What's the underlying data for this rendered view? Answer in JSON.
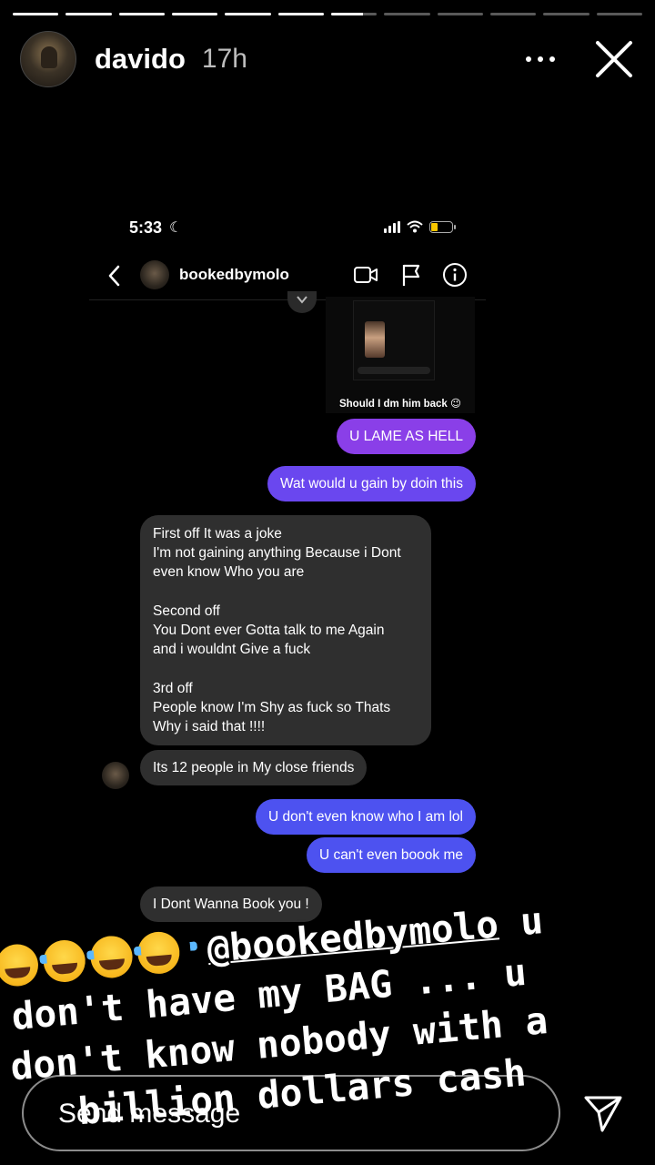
{
  "story": {
    "username": "davido",
    "time": "17h",
    "segments": [
      1,
      1,
      1,
      1,
      1,
      1,
      0.7,
      0,
      0,
      0,
      0,
      0
    ]
  },
  "embedded": {
    "status_time": "5:33",
    "chat_name": "bookedbymolo",
    "shared_caption": "Should I dm him back 😉",
    "messages": [
      {
        "from": "me",
        "text": "U LAME AS HELL"
      },
      {
        "from": "me",
        "text": "Wat would u gain by doin this"
      },
      {
        "from": "them",
        "lines": [
          "First off It was a joke",
          "I'm not gaining anything Because i Dont",
          "even know Who you are",
          "",
          "Second off",
          "You Dont ever Gotta talk to me Again",
          "and i wouldnt Give a fuck",
          "",
          "3rd off",
          "People know I'm Shy as fuck so Thats",
          "Why i said that !!!!"
        ]
      },
      {
        "from": "them",
        "text": "Its 12 people in My close friends"
      },
      {
        "from": "me",
        "text": "U don't even know who I am lol"
      },
      {
        "from": "me",
        "text": "U can't even boook me"
      },
      {
        "from": "them",
        "text": "I Dont Wanna Book you !"
      }
    ]
  },
  "caption": {
    "line1_mention": "@bookedbymolo",
    "line1_tail": " u",
    "line2": "don't have my BAG ... u",
    "line3": "don't know nobody with a",
    "line4": "billion dollars cash"
  },
  "reply": {
    "placeholder": "Send message"
  },
  "colors": {
    "me_purple": "#8a3fe8",
    "me_blue": "#4d52f0",
    "them_gray": "#2f2f2f",
    "battery": "#f7c600"
  },
  "icons": [
    "more-icon",
    "close-icon",
    "back-icon",
    "video-call-icon",
    "flag-icon",
    "info-icon",
    "send-icon",
    "laughing-emoji"
  ]
}
